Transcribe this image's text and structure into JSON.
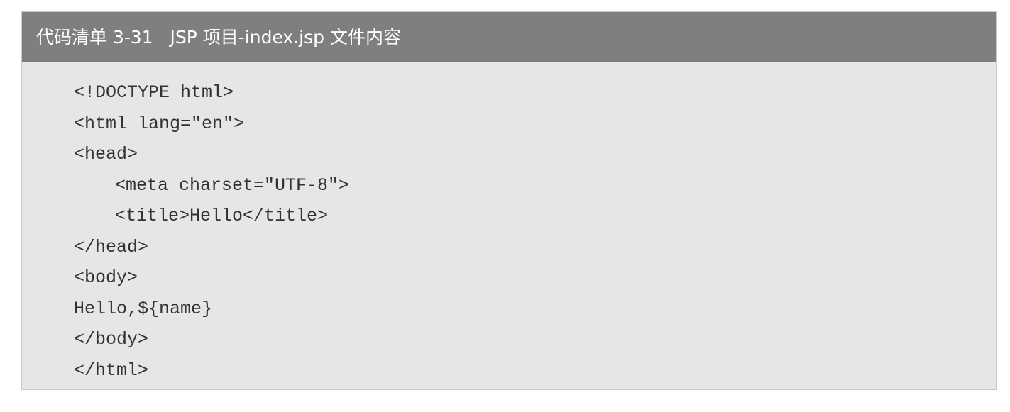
{
  "listing": {
    "title": "代码清单 3-31   JSP 项目-index.jsp 文件内容",
    "lines": [
      {
        "text": "<!DOCTYPE html>",
        "indent": 0
      },
      {
        "text": "<html lang=\"en\">",
        "indent": 0
      },
      {
        "text": "<head>",
        "indent": 0
      },
      {
        "text": "<meta charset=\"UTF-8\">",
        "indent": 1
      },
      {
        "text": "<title>Hello</title>",
        "indent": 1
      },
      {
        "text": "</head>",
        "indent": 0
      },
      {
        "text": "<body>",
        "indent": 0
      },
      {
        "text": "Hello,${name}",
        "indent": 0
      },
      {
        "text": "</body>",
        "indent": 0
      },
      {
        "text": "</html>",
        "indent": 0
      }
    ]
  },
  "colors": {
    "header_bg": "#7f7f7f",
    "body_bg": "#e6e6e6",
    "code_text": "#333333",
    "title_text": "#ffffff"
  }
}
